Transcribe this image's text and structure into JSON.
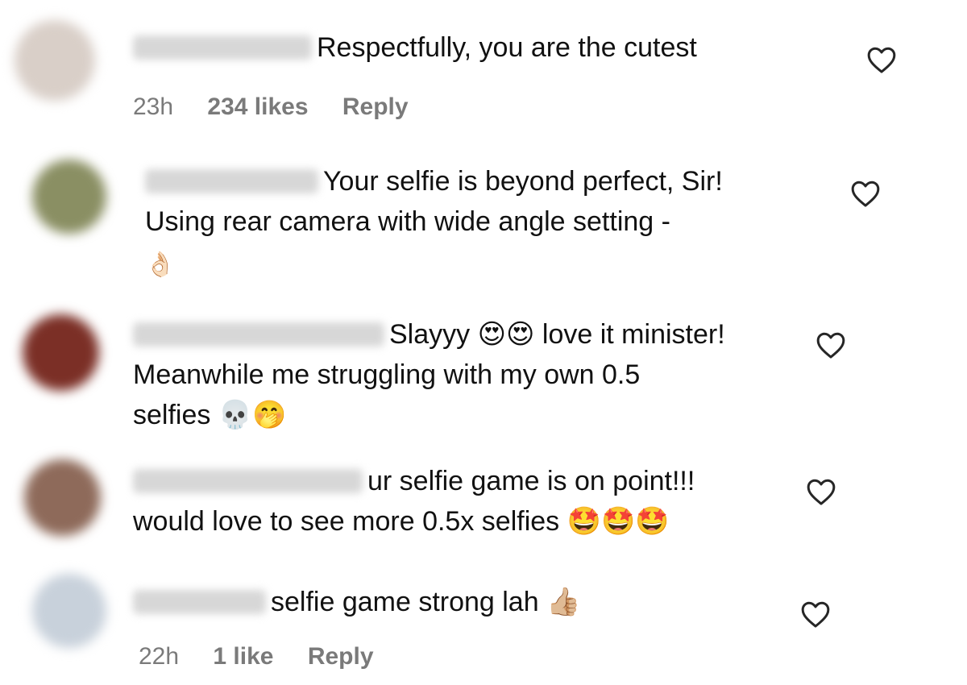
{
  "comments": [
    {
      "text": "Respectfully, you are the cutest",
      "text_line2": "",
      "text_line3": "",
      "time": "23h",
      "likes": "234 likes",
      "reply": "Reply",
      "avatar_color": "#d9cfc8",
      "username_bar_color": "#cfcfcf"
    },
    {
      "text": "Your selfie is beyond perfect, Sir!",
      "text_line2": "Using rear camera with wide angle setting -",
      "text_line3": "👌🏻",
      "avatar_color": "#8a8f63",
      "username_bar_color": "#d6d6d6"
    },
    {
      "text": "Slayyy 😍😍 love it minister!",
      "text_line2": "Meanwhile me struggling with my own 0.5",
      "text_line3": "selfies 💀🤭",
      "avatar_color": "#7b2f26",
      "username_bar_color": "#cdcdcd"
    },
    {
      "text": "ur selfie game is on point!!!",
      "text_line2": "would love to see more 0.5x selfies 🤩🤩🤩",
      "text_line3": "",
      "avatar_color": "#8e6a5a",
      "username_bar_color": "#d2d2d2"
    },
    {
      "text": "selfie game strong lah 👍🏼",
      "text_line2": "",
      "text_line3": "",
      "time": "22h",
      "likes": "1 like",
      "reply": "Reply",
      "avatar_color": "#c8d1db",
      "username_bar_color": "#d0d0d0"
    }
  ],
  "icons": {
    "like": "heart-outline-icon"
  },
  "colors": {
    "text": "#111111",
    "meta": "#7a7a7a",
    "background": "#ffffff"
  }
}
